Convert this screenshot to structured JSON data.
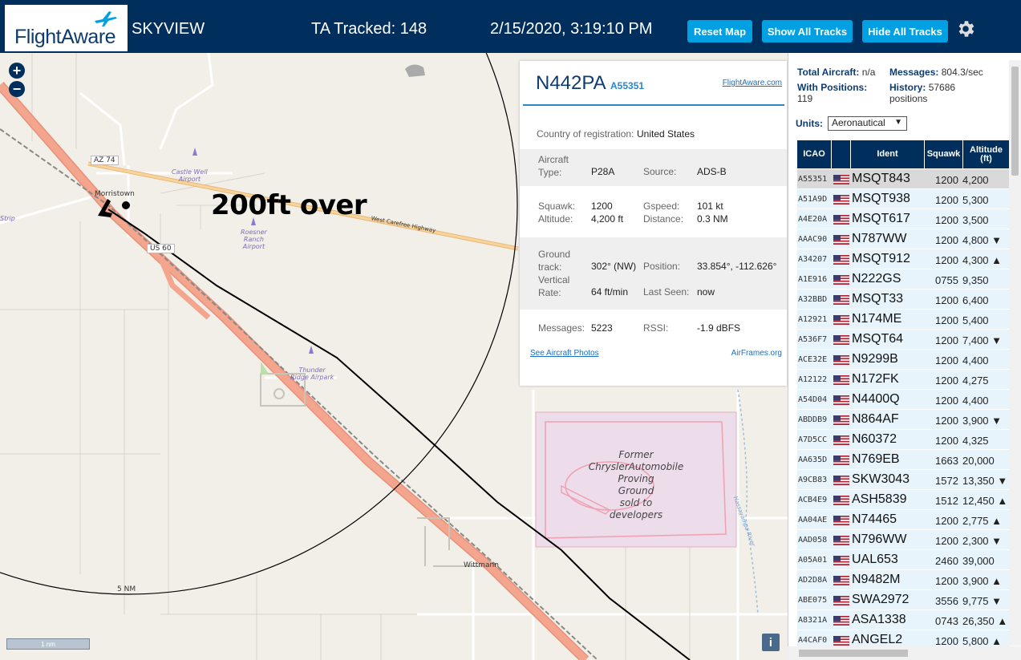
{
  "header": {
    "logo_text": "FlightAware",
    "app_name": "SKYVIEW",
    "tracked": "TA Tracked: 148",
    "datetime": "2/15/2020, 3:19:10 PM",
    "reset_map": "Reset Map",
    "show_all_tracks": "Show All Tracks",
    "hide_all_tracks": "Hide All Tracks",
    "settings_icon": "gear-icon"
  },
  "map": {
    "zoom_in": "+",
    "zoom_out": "−",
    "annotation": "200ft over",
    "scale": "1 nm",
    "range_ring": "5 NM",
    "info": "i",
    "labels": {
      "az74": "AZ 74",
      "us60": "US 60",
      "morristown": "Morristown",
      "wittmann": "Wittmann",
      "strip": "Strip",
      "highway": "West Carefree Highway",
      "castle_well": "Castle Well\nAirport",
      "roesner": "Roesner\nRanch\nAirport",
      "thunder_ridge": "Thunder\nRidge Airpark",
      "proving_ground": "Former\nChryslerAutomobile\nProving\nGround\nsold to\ndevelopers",
      "river": "Hassayampa River"
    }
  },
  "detail": {
    "registration": "N442PA",
    "hex": "A55351",
    "fa_link": "FlightAware.com",
    "country_label": "Country of registration:",
    "country": "United States",
    "aircraft_type_label": "Aircraft\nType:",
    "aircraft_type": "P28A",
    "source_label": "Source:",
    "source": "ADS-B",
    "squawk_label": "Squawk:",
    "squawk": "1200",
    "gspeed_label": "Gspeed:",
    "gspeed": "101 kt",
    "altitude_label": "Altitude:",
    "altitude": "4,200 ft",
    "distance_label": "Distance:",
    "distance": "0.3 NM",
    "track_label": "Ground\ntrack:",
    "track": "302° (NW)",
    "position_label": "Position:",
    "position": "33.854°, -112.626°",
    "vrate_label": "Vertical\nRate:",
    "vrate": "64 ft/min",
    "lastseen_label": "Last Seen:",
    "lastseen": "now",
    "messages_label": "Messages:",
    "messages": "5223",
    "rssi_label": "RSSI:",
    "rssi": "-1.9 dBFS",
    "photos_link": "See Aircraft Photos",
    "airframes_link": "AirFrames.org"
  },
  "stats": {
    "total_label": "Total Aircraft:",
    "total": "n/a",
    "messages_label": "Messages:",
    "messages": "804.3/sec",
    "positions_label": "With Positions:",
    "positions": "119",
    "history_label": "History:",
    "history": "57686\npositions",
    "units_label": "Units:",
    "units": "Aeronautical"
  },
  "table": {
    "headers": [
      "ICAO",
      "",
      "Ident",
      "Squawk",
      "Altitude\n(ft)"
    ],
    "rows": [
      {
        "icao": "A55351",
        "ident": "MSQT843",
        "squawk": "1200",
        "alt": "4,200",
        "selected": true
      },
      {
        "icao": "A51A9D",
        "ident": "MSQT938",
        "squawk": "1200",
        "alt": "5,300"
      },
      {
        "icao": "A4E20A",
        "ident": "MSQT617",
        "squawk": "1200",
        "alt": "3,500"
      },
      {
        "icao": "AAAC90",
        "ident": "N787WW",
        "squawk": "1200",
        "alt": "4,800 ▼"
      },
      {
        "icao": "A34207",
        "ident": "MSQT912",
        "squawk": "1200",
        "alt": "4,300 ▲"
      },
      {
        "icao": "A1E916",
        "ident": "N222GS",
        "squawk": "0755",
        "alt": "9,350"
      },
      {
        "icao": "A32BBD",
        "ident": "MSQT33",
        "squawk": "1200",
        "alt": "6,400"
      },
      {
        "icao": "A12921",
        "ident": "N174ME",
        "squawk": "1200",
        "alt": "5,400"
      },
      {
        "icao": "A536F7",
        "ident": "MSQT64",
        "squawk": "1200",
        "alt": "7,400 ▼"
      },
      {
        "icao": "ACE32E",
        "ident": "N9299B",
        "squawk": "1200",
        "alt": "4,400"
      },
      {
        "icao": "A12122",
        "ident": "N172FK",
        "squawk": "1200",
        "alt": "4,275"
      },
      {
        "icao": "A54D04",
        "ident": "N4400Q",
        "squawk": "1200",
        "alt": "4,400"
      },
      {
        "icao": "ABDDB9",
        "ident": "N864AF",
        "squawk": "1200",
        "alt": "3,900 ▼"
      },
      {
        "icao": "A7D5CC",
        "ident": "N60372",
        "squawk": "1200",
        "alt": "4,325"
      },
      {
        "icao": "AA635D",
        "ident": "N769EB",
        "squawk": "1663",
        "alt": "20,000"
      },
      {
        "icao": "A9CB83",
        "ident": "SKW3043",
        "squawk": "1572",
        "alt": "13,350 ▼"
      },
      {
        "icao": "ACB4E9",
        "ident": "ASH5839",
        "squawk": "1512",
        "alt": "12,450 ▲"
      },
      {
        "icao": "AA04AE",
        "ident": "N74465",
        "squawk": "1200",
        "alt": "2,775 ▲"
      },
      {
        "icao": "AAD058",
        "ident": "N796WW",
        "squawk": "1200",
        "alt": "2,300 ▼"
      },
      {
        "icao": "A05A01",
        "ident": "UAL653",
        "squawk": "2460",
        "alt": "39,000"
      },
      {
        "icao": "AD2D8A",
        "ident": "N9482M",
        "squawk": "1200",
        "alt": "3,900 ▲"
      },
      {
        "icao": "ABE075",
        "ident": "SWA2972",
        "squawk": "3556",
        "alt": "9,775 ▼"
      },
      {
        "icao": "A8321A",
        "ident": "ASA1338",
        "squawk": "0743",
        "alt": "26,350 ▲"
      },
      {
        "icao": "A4CAF0",
        "ident": "ANGEL2",
        "squawk": "1200",
        "alt": "5,800 ▲"
      }
    ]
  },
  "colors": {
    "header_bg": "#002f5d",
    "button": "#00a0e2",
    "row_bg": "#e8f4fb",
    "selected_row": "#d9d9d9",
    "highway": "#f3a58e",
    "track_line": "#000000"
  }
}
